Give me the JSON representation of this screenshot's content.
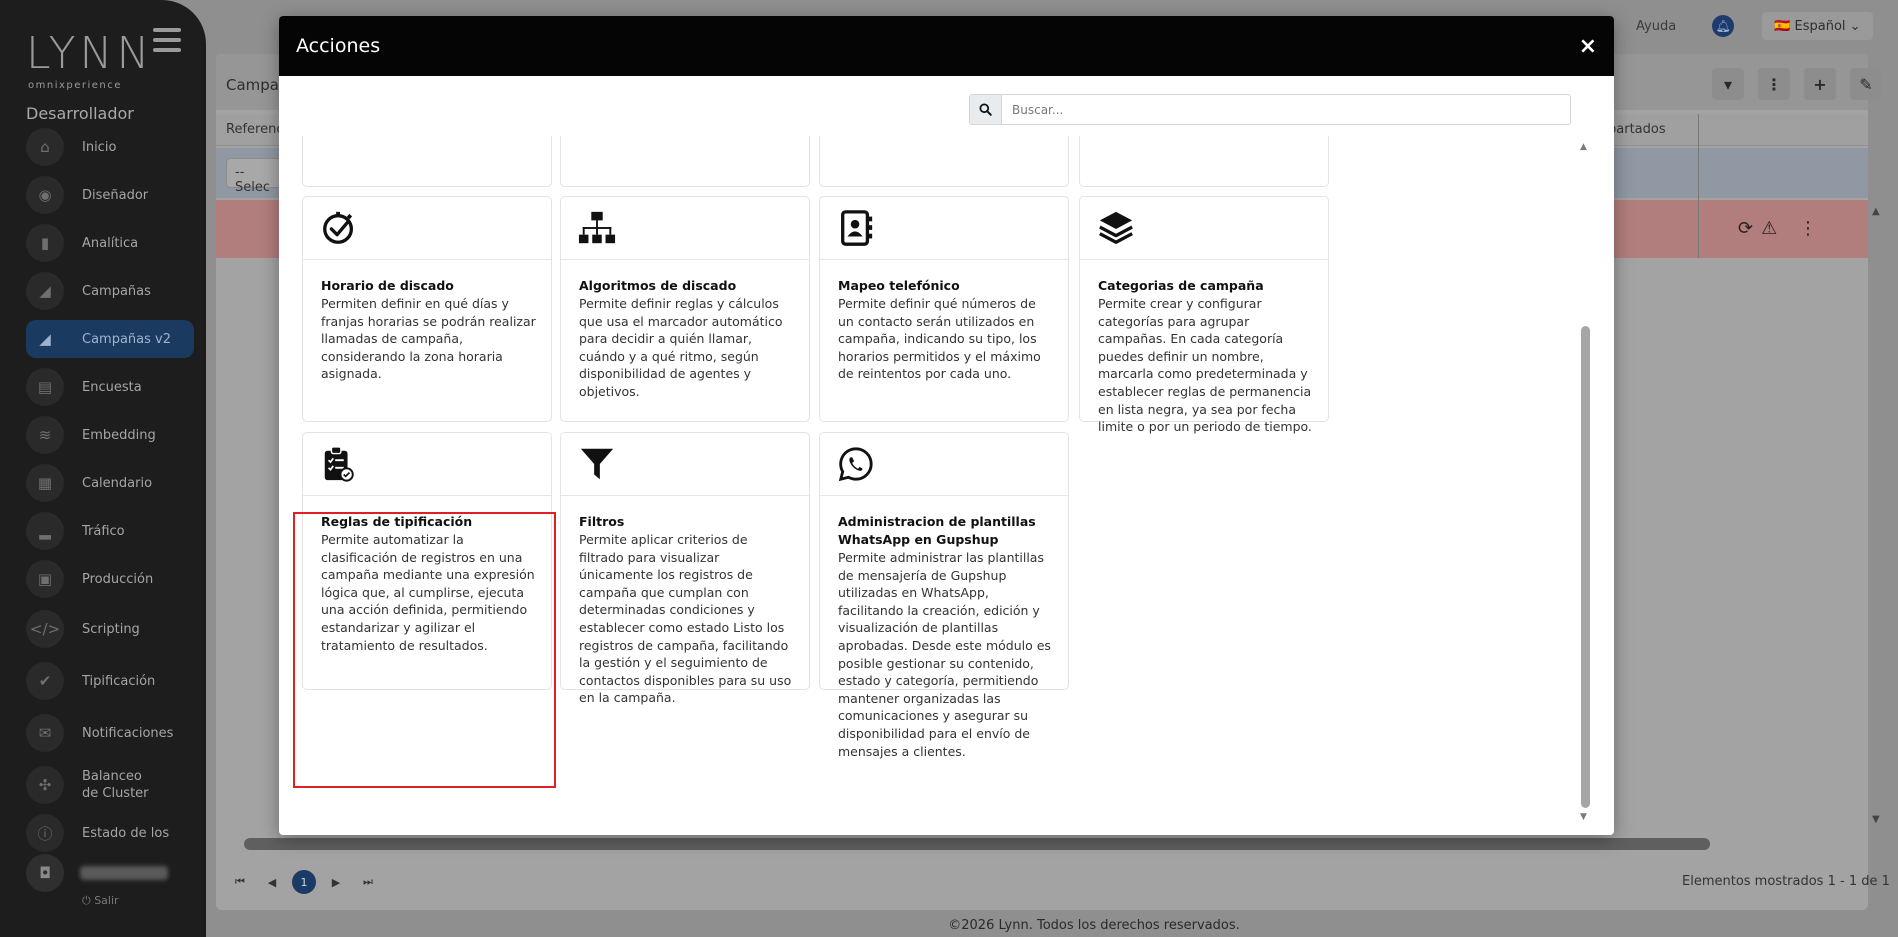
{
  "sidebar": {
    "logo": "LYNN",
    "logo_sub": "omnixperience",
    "role": "Desarrollador",
    "items": [
      {
        "label": "Inicio",
        "icon": "home-icon",
        "glyph": "⌂"
      },
      {
        "label": "Diseñador",
        "icon": "palette-icon",
        "glyph": "◉"
      },
      {
        "label": "Analítica",
        "icon": "bar-chart-icon",
        "glyph": "▮"
      },
      {
        "label": "Campañas",
        "icon": "megaphone-icon",
        "glyph": "◢"
      },
      {
        "label": "Campañas v2",
        "icon": "megaphone-icon",
        "glyph": "◢"
      },
      {
        "label": "Encuesta",
        "icon": "clipboard-icon",
        "glyph": "▤"
      },
      {
        "label": "Embedding",
        "icon": "database-icon",
        "glyph": "≋"
      },
      {
        "label": "Calendario",
        "icon": "calendar-icon",
        "glyph": "▦"
      },
      {
        "label": "Tráfico",
        "icon": "signal-icon",
        "glyph": "▂"
      },
      {
        "label": "Producción",
        "icon": "briefcase-icon",
        "glyph": "▣"
      },
      {
        "label": "Scripting",
        "icon": "code-icon",
        "glyph": "</>"
      },
      {
        "label": "Tipificación",
        "icon": "check-circle-icon",
        "glyph": "✔"
      },
      {
        "label": "Notificaciones",
        "icon": "notification-icon",
        "glyph": "✉"
      },
      {
        "label": "Balanceo de Cluster",
        "icon": "network-icon",
        "glyph": "✣"
      },
      {
        "label": "Estado de los",
        "icon": "info-icon",
        "glyph": "ⓘ"
      }
    ],
    "active_index": 4,
    "salir": "Salir"
  },
  "topbar": {
    "help": "Ayuda",
    "language": "Español"
  },
  "background": {
    "title": "Campa",
    "col_ref": "Referenc",
    "col_apartados": "partados",
    "select_value": "--Selec",
    "page_current": "1",
    "elements_shown": "Elementos mostrados 1 - 1 de 1",
    "footer": "©2026 Lynn. Todos los derechos reservados."
  },
  "modal": {
    "title": "Acciones",
    "close": "×",
    "search_placeholder": "Buscar...",
    "cards": [
      {
        "title": "Horario de discado",
        "desc": "Permiten definir en qué días y franjas horarias se podrán realizar llamadas de campaña, considerando la zona horaria asignada.",
        "icon": "clock-check-icon"
      },
      {
        "title": "Algoritmos de discado",
        "desc": "Permite definir reglas y cálculos que usa el marcador automático para decidir a quién llamar, cuándo y a qué ritmo, según disponibilidad de agentes y objetivos.",
        "icon": "sitemap-icon"
      },
      {
        "title": "Mapeo telefónico",
        "desc": "Permite definir qué números de un contacto serán utilizados en campaña, indicando su tipo, los horarios permitidos y el máximo de reintentos por cada uno.",
        "icon": "address-book-icon"
      },
      {
        "title": "Categorias de campaña",
        "desc": "Permite crear y configurar categorías para agrupar campañas. En cada categoría puedes definir un nombre, marcarla como predeterminada y establecer reglas de permanencia en lista negra, ya sea por fecha limite o por un periodo de tiempo.",
        "icon": "layers-icon"
      },
      {
        "title": "Reglas de tipificación",
        "desc": "Permite automatizar la clasificación de registros en una campaña mediante una expresión lógica que, al cumplirse, ejecuta una acción definida, permitiendo estandarizar y agilizar el tratamiento de resultados.",
        "icon": "clipboard-check-icon"
      },
      {
        "title": "Filtros",
        "desc": "Permite aplicar criterios de filtrado para visualizar únicamente los registros de campaña que cumplan con determinadas condiciones y establecer como estado Listo los registros de campaña, facilitando la gestión y el seguimiento de contactos disponibles para su uso en la campaña.",
        "icon": "filter-icon"
      },
      {
        "title": "Administracion de plantillas WhatsApp en Gupshup",
        "desc": "Permite administrar las plantillas de mensajería de Gupshup utilizadas en WhatsApp, facilitando la creación, edición y visualización de plantillas aprobadas. Desde este módulo es posible gestionar su contenido, estado y categoría, permitiendo mantener organizadas las comunicaciones y asegurar su disponibilidad para el envío de mensajes a clientes.",
        "icon": "whatsapp-icon"
      }
    ]
  }
}
